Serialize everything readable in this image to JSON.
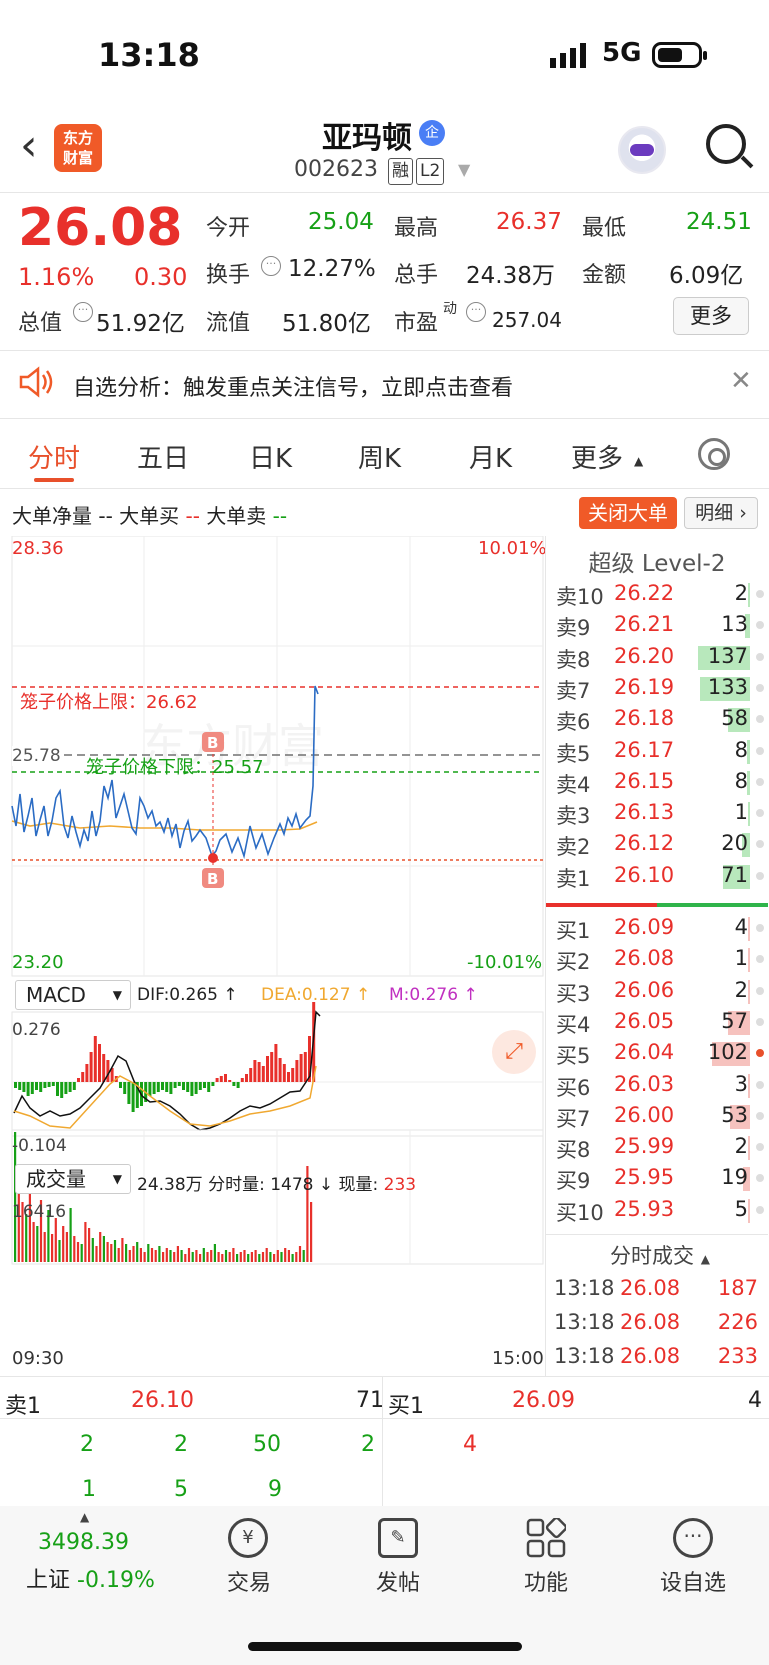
{
  "status_bar": {
    "time": "13:18",
    "network": "5G"
  },
  "header": {
    "logo_line1": "东方",
    "logo_line2": "财富",
    "stock_name": "亚玛顿",
    "badge": "企",
    "stock_code": "002623",
    "tag_rong": "融",
    "tag_l2": "L2"
  },
  "quote": {
    "price": "26.08",
    "pct": "1.16%",
    "change": "0.30",
    "open_label": "今开",
    "open": "25.04",
    "high_label": "最高",
    "high": "26.37",
    "low_label": "最低",
    "low": "24.51",
    "turnover_label": "换手",
    "turnover": "12.27%",
    "volume_label": "总手",
    "volume": "24.38万",
    "amount_label": "金额",
    "amount": "6.09亿",
    "mcap_label": "总值",
    "mcap": "51.92亿",
    "float_label": "流值",
    "float": "51.80亿",
    "pe_label": "市盈",
    "pe_sup": "动",
    "pe": "257.04",
    "more": "更多"
  },
  "notice": {
    "text": "自选分析：触发重点关注信号，立即点击查看"
  },
  "tabs": [
    "分时",
    "五日",
    "日K",
    "周K",
    "月K",
    "更多"
  ],
  "legend": {
    "net": "大单净量",
    "net_val": "--",
    "buy": "大单买",
    "buy_val": "--",
    "sell": "大单卖",
    "sell_val": "--",
    "close_btn": "关闭大单",
    "detail_btn": "明细"
  },
  "chart": {
    "top_price": "28.36",
    "top_pct": "10.01%",
    "bottom_price": "23.20",
    "bottom_pct": "-10.01%",
    "prev_close": "25.78",
    "cage_upper": "笼子价格上限：26.62",
    "cage_lower": "笼子价格下限：25.57",
    "marker": "B",
    "macd_select": "MACD",
    "dif": "DIF:0.265 ↑",
    "dea": "DEA:0.127 ↑",
    "m": "M:0.276 ↑",
    "macd_top": "0.276",
    "macd_bottom": "-0.104",
    "vol_select": "成交量",
    "vol_info": "24.38万 分时量: 1478 ↓ 现量:",
    "vol_now": "233",
    "vol_top": "16416",
    "time_start": "09:30",
    "time_end": "15:00"
  },
  "level2": {
    "title": "超级 Level-2",
    "asks": [
      {
        "label": "卖10",
        "price": "26.22",
        "vol": "2",
        "bar": 0.02
      },
      {
        "label": "卖9",
        "price": "26.21",
        "vol": "13",
        "bar": 0.09
      },
      {
        "label": "卖8",
        "price": "26.20",
        "vol": "137",
        "bar": 1.0
      },
      {
        "label": "卖7",
        "price": "26.19",
        "vol": "133",
        "bar": 0.97
      },
      {
        "label": "卖6",
        "price": "26.18",
        "vol": "58",
        "bar": 0.42
      },
      {
        "label": "卖5",
        "price": "26.17",
        "vol": "8",
        "bar": 0.06
      },
      {
        "label": "卖4",
        "price": "26.15",
        "vol": "8",
        "bar": 0.06
      },
      {
        "label": "卖3",
        "price": "26.13",
        "vol": "1",
        "bar": 0.01
      },
      {
        "label": "卖2",
        "price": "26.12",
        "vol": "20",
        "bar": 0.15
      },
      {
        "label": "卖1",
        "price": "26.10",
        "vol": "71",
        "bar": 0.52
      }
    ],
    "bids": [
      {
        "label": "买1",
        "price": "26.09",
        "vol": "4",
        "bar": 0.03
      },
      {
        "label": "买2",
        "price": "26.08",
        "vol": "1",
        "bar": 0.01
      },
      {
        "label": "买3",
        "price": "26.06",
        "vol": "2",
        "bar": 0.02
      },
      {
        "label": "买4",
        "price": "26.05",
        "vol": "57",
        "bar": 0.42
      },
      {
        "label": "买5",
        "price": "26.04",
        "vol": "102",
        "bar": 0.74
      },
      {
        "label": "买6",
        "price": "26.03",
        "vol": "3",
        "bar": 0.02
      },
      {
        "label": "买7",
        "price": "26.00",
        "vol": "53",
        "bar": 0.39
      },
      {
        "label": "买8",
        "price": "25.99",
        "vol": "2",
        "bar": 0.02
      },
      {
        "label": "买9",
        "price": "25.95",
        "vol": "19",
        "bar": 0.14
      },
      {
        "label": "买10",
        "price": "25.93",
        "vol": "5",
        "bar": 0.04
      }
    ],
    "ticks_title": "分时成交",
    "ticks": [
      {
        "time": "13:18",
        "price": "26.08",
        "vol": "187"
      },
      {
        "time": "13:18",
        "price": "26.08",
        "vol": "226"
      },
      {
        "time": "13:18",
        "price": "26.08",
        "vol": "233"
      }
    ]
  },
  "bottom_quote": {
    "ask_label": "卖1",
    "ask_price": "26.10",
    "ask_vol": "71",
    "bid_label": "买1",
    "bid_price": "26.09",
    "bid_vol": "4",
    "ask_queue_row1": [
      "2",
      "2",
      "50",
      "2"
    ],
    "ask_queue_row2": [
      "1",
      "5",
      "9"
    ],
    "bid_queue_row1": [
      "4"
    ]
  },
  "footer": {
    "index_value": "3498.39",
    "index_name": "上证",
    "index_pct": "-0.19%",
    "items": [
      "交易",
      "发帖",
      "功能",
      "设自选"
    ]
  }
}
